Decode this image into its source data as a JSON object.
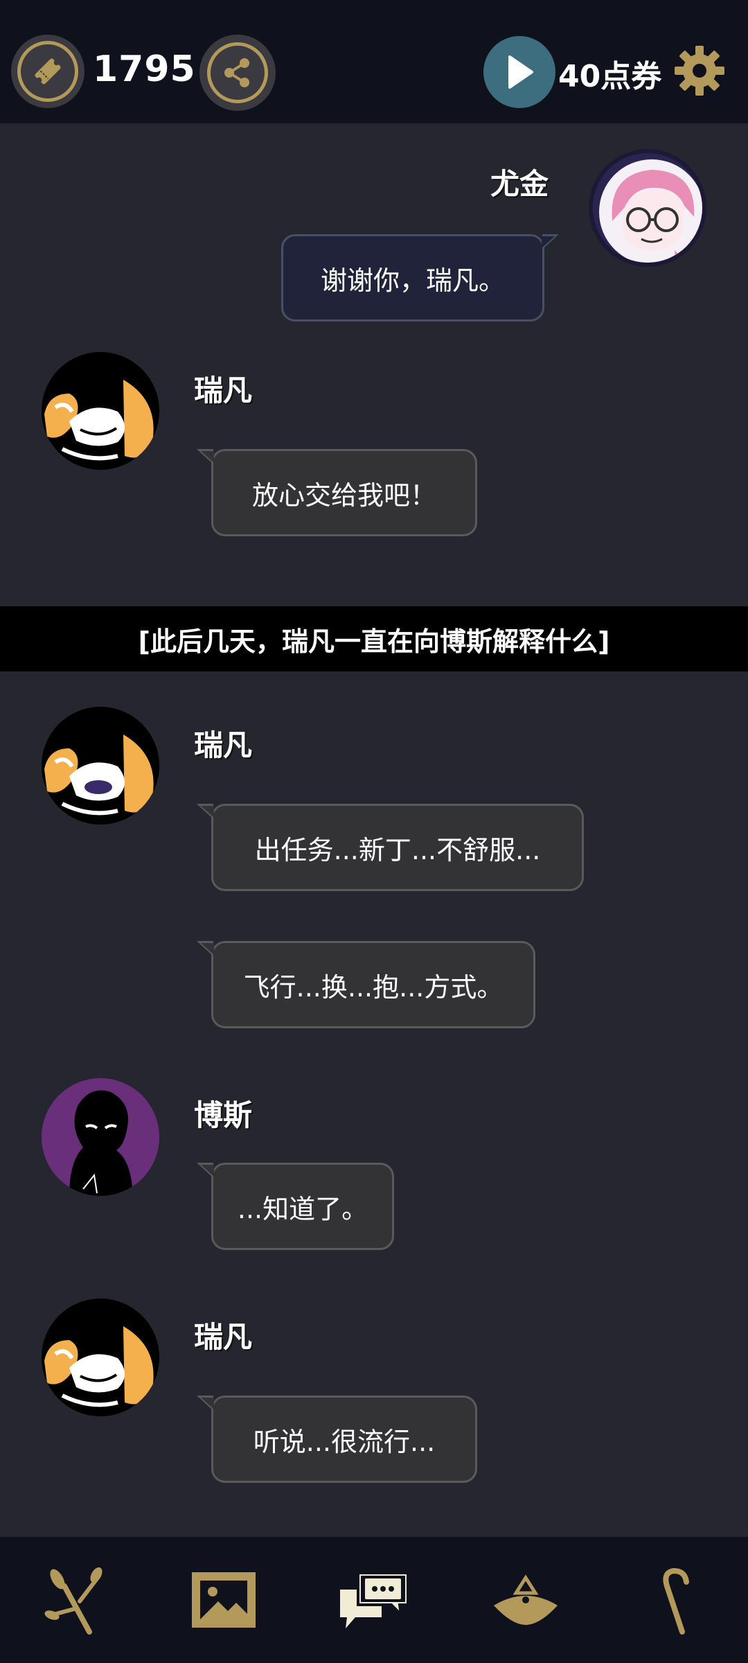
{
  "topbar": {
    "ticket_count": "1795",
    "points_label": "40点券",
    "icons": [
      "ticket-icon",
      "share-icon",
      "play-icon",
      "gear-icon"
    ]
  },
  "colors": {
    "bar_bg": "#0f121d",
    "chat_bg": "#262630",
    "gold": "#b49a5a",
    "play_teal": "#3d6e80",
    "bubble_bg": "#333336",
    "player_bubble_bg": "#20233a"
  },
  "chat": {
    "messages": [
      {
        "speaker": "尤金",
        "text": "谢谢你，瑞凡。"
      },
      {
        "speaker": "瑞凡",
        "text": "放心交给我吧！"
      },
      {
        "narration": "[此后几天，瑞凡一直在向博斯解释什么]"
      },
      {
        "speaker": "瑞凡",
        "text": "出任务...新丁...不舒服..."
      },
      {
        "speaker": "",
        "text": "飞行...换...抱...方式。"
      },
      {
        "speaker": "博斯",
        "text": "...知道了。"
      },
      {
        "speaker": "瑞凡",
        "text": "听说...很流行..."
      }
    ]
  },
  "bottomnav": {
    "items": [
      "branch-icon",
      "gallery-icon",
      "chat-icon",
      "hat-icon",
      "cane-icon"
    ]
  }
}
